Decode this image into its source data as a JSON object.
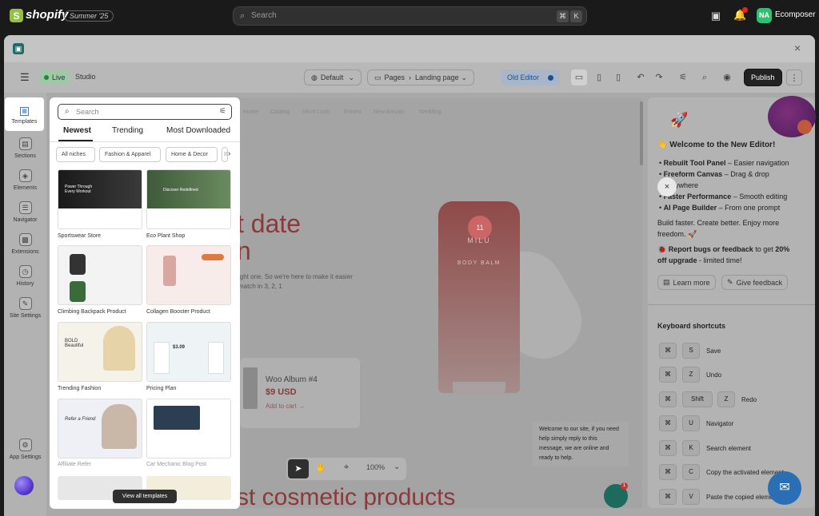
{
  "shopify": {
    "brand": "shopify",
    "logo_letter": "S",
    "edition": "Summer '25",
    "search_placeholder": "Search",
    "kbd1": "⌘",
    "kbd2": "K",
    "bell_badge": "1",
    "user_initials": "NA",
    "user_name": "Ecomposer"
  },
  "app": {
    "close_label": "×",
    "icon_glyph": "▣"
  },
  "toolbar": {
    "menu_icon": "☰",
    "live": "Live",
    "studio": "Studio",
    "theme": "Default",
    "pages": "Pages",
    "page_name": "Landing page",
    "old_editor": "Old Editor",
    "publish": "Publish"
  },
  "rail": {
    "items": [
      {
        "label": "Templates",
        "icon": "▦"
      },
      {
        "label": "Sections",
        "icon": "▤"
      },
      {
        "label": "Elements",
        "icon": "◈"
      },
      {
        "label": "Navigator",
        "icon": "☰"
      },
      {
        "label": "Extensions",
        "icon": "▩"
      },
      {
        "label": "History",
        "icon": "◷"
      },
      {
        "label": "Site Settings",
        "icon": "✎"
      },
      {
        "label": "App Settings",
        "icon": "⚙"
      }
    ]
  },
  "templates_panel": {
    "search_placeholder": "Search",
    "tabs": [
      "Newest",
      "Trending",
      "Most Downloaded"
    ],
    "chips": [
      "All niches",
      "Fashion & Apparel",
      "Home & Decor",
      "Be"
    ],
    "cards": [
      {
        "name": "Sportswear Store",
        "thumb_text": "Power Through Every Workout"
      },
      {
        "name": "Eco Plant Shop",
        "thumb_text": "Discover Redefined"
      },
      {
        "name": "Climbing Backpack Product",
        "thumb_text": ""
      },
      {
        "name": "Collagen Booster Product",
        "thumb_text": ""
      },
      {
        "name": "Trending Fashion",
        "thumb_text": "BOLD Beautiful"
      },
      {
        "name": "Pricing Plan",
        "thumb_text": "$3.09"
      },
      {
        "name": "Affiliate Refer",
        "thumb_text": "Refer a Friend"
      },
      {
        "name": "Car Mechanic Blog Post",
        "thumb_text": ""
      }
    ],
    "view_all": "View all templates"
  },
  "canvas": {
    "nav": [
      "Home",
      "Catalog",
      "Short Look",
      "Entries",
      "New Arrivals",
      "Wedding"
    ],
    "hero_line1": "t date",
    "hero_line2": "n",
    "copy_line1": "ight one. So we're here to make it easier",
    "copy_line2": "match in 3, 2, 1",
    "brand_logo": "11",
    "brand_name": "MILU",
    "product_label": "BODY BALM",
    "card_title": "Woo Album #4",
    "card_price": "$9 USD",
    "card_cta": "Add to cart →",
    "bottom_text": "st cosmetic products",
    "chat_message": "Welcome to our site, if you need help simply reply to this message, we are online and ready to help.",
    "chat_badge": "1",
    "zoom": "100%"
  },
  "welcome": {
    "title": "👋 Welcome to the New Editor!",
    "features": [
      {
        "bold": "Rebuilt Tool Panel",
        "rest": " – Easier navigation"
      },
      {
        "bold": "Freeform Canvas",
        "rest": " – Drag & drop"
      },
      {
        "bold": "",
        "rest": "anywhere"
      },
      {
        "bold": "Faster Performance",
        "rest": " – Smooth editing"
      },
      {
        "bold": "AI Page Builder",
        "rest": " – From one prompt"
      }
    ],
    "tagline1": "Build faster. Create better. Enjoy more",
    "tagline2": "freedom. 🚀",
    "report_bold": "🐞 Report bugs or feedback",
    "report_rest": " to get ",
    "report_off": "20%",
    "report_line2_bold": "off upgrade",
    "report_line2_rest": " - limited time!",
    "learn_more": "Learn more",
    "give_feedback": "Give feedback",
    "shortcuts_title": "Keyboard shortcuts",
    "shortcuts": [
      {
        "key": "S",
        "label": "Save"
      },
      {
        "key": "Z",
        "label": "Undo"
      },
      {
        "key": "Shift",
        "key2": "Z",
        "label": "Redo"
      },
      {
        "key": "U",
        "label": "Navigator"
      },
      {
        "key": "K",
        "label": "Search element"
      },
      {
        "key": "C",
        "label": "Copy the activated element"
      },
      {
        "key": "V",
        "label": "Paste the copied element"
      }
    ],
    "cmd": "⌘",
    "close": "×"
  }
}
